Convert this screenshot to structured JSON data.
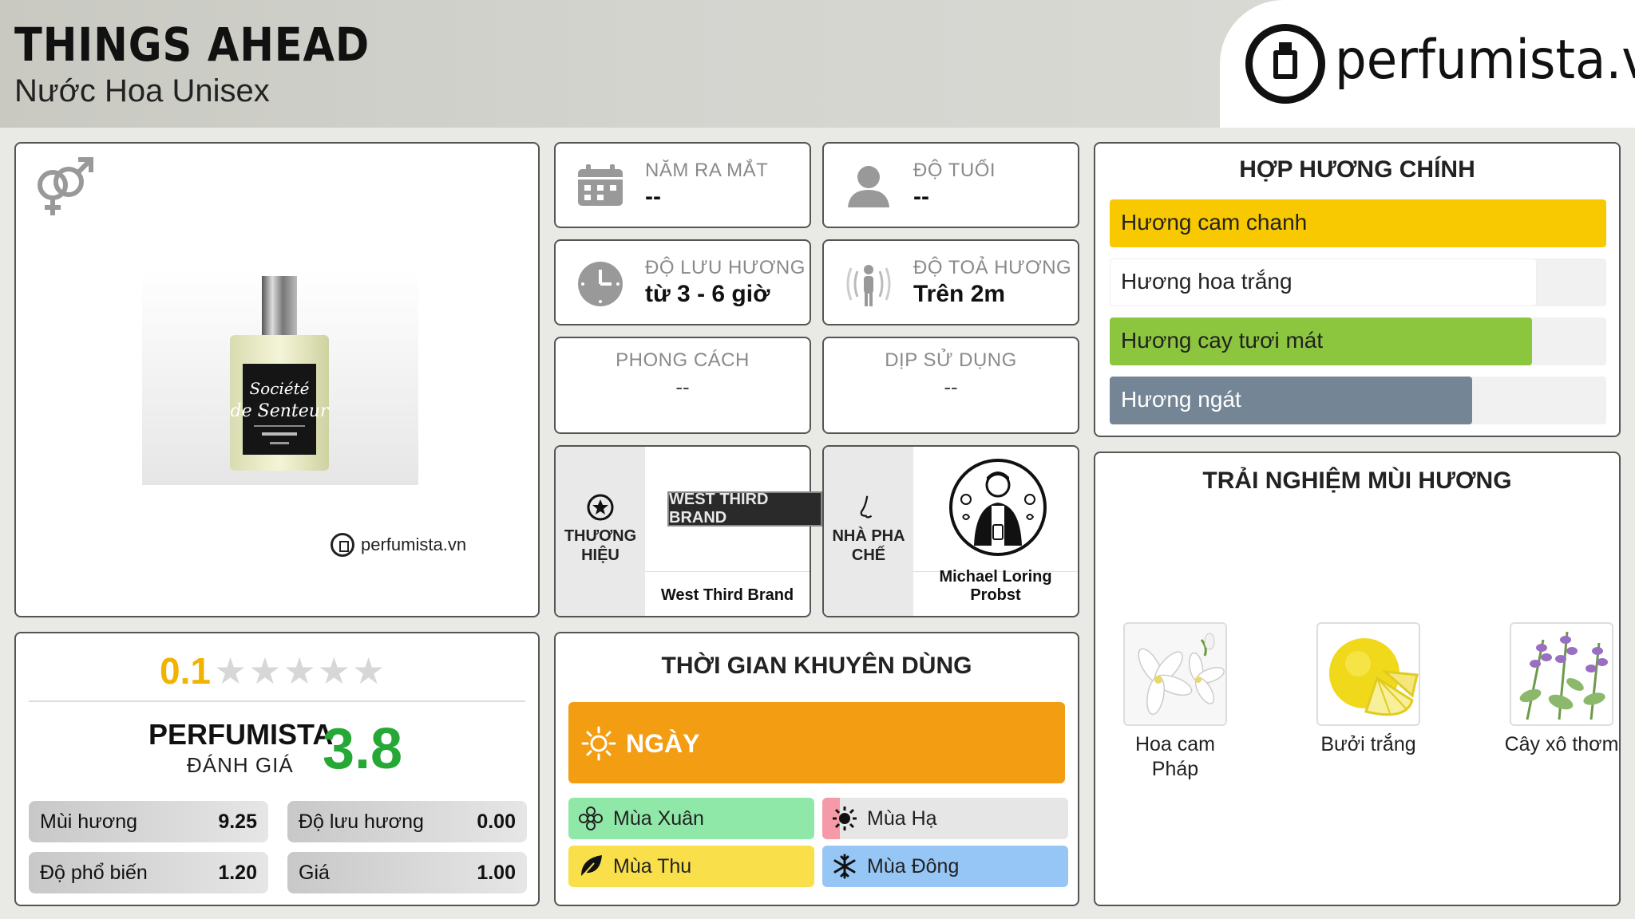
{
  "header": {
    "title": "THINGS AHEAD",
    "subtitle": "Nước Hoa Unisex",
    "site": "perfumista.vn"
  },
  "product": {
    "watermark": "perfumista.vn",
    "gender_icon": "unisex-gender-icon"
  },
  "info": {
    "release": {
      "label": "NĂM RA MẮT",
      "value": "--"
    },
    "age": {
      "label": "ĐỘ TUỔI",
      "value": "--"
    },
    "longevity": {
      "label": "ĐỘ LƯU HƯƠNG",
      "value": "từ 3 - 6 giờ"
    },
    "sillage": {
      "label": "ĐỘ TOẢ HƯƠNG",
      "value": "Trên 2m"
    },
    "style": {
      "label": "PHONG CÁCH",
      "value": "--"
    },
    "occasion": {
      "label": "DỊP SỬ DỤNG",
      "value": "--"
    }
  },
  "brand": {
    "label": "THƯƠNG HIỆU",
    "name": "West Third Brand",
    "logo_text": "WEST THIRD BRAND"
  },
  "perfumer": {
    "label": "NHÀ PHA CHẾ",
    "name": "Michael Loring Probst"
  },
  "accords": {
    "title": "HỢP HƯƠNG CHÍNH",
    "items": [
      {
        "label": "Hương cam chanh",
        "level": 1.0,
        "color": "#f8c800"
      },
      {
        "label": "Hương hoa trắng",
        "level": 0.86,
        "color": "#ffffff"
      },
      {
        "label": "Hương cay tươi mát",
        "level": 0.85,
        "color": "#8cc63e"
      },
      {
        "label": "Hương ngát",
        "level": 0.73,
        "color": "#748595"
      }
    ]
  },
  "rating": {
    "score": "0.1",
    "stars_filled": 0,
    "stars_total": 5,
    "brand_label": "PERFUMISTA",
    "sub_label": "ĐÁNH GIÁ",
    "brand_score": "3.8",
    "metrics": [
      {
        "label": "Mùi hương",
        "value": "9.25"
      },
      {
        "label": "Độ lưu hương",
        "value": "0.00"
      },
      {
        "label": "Độ phổ biến",
        "value": "1.20"
      },
      {
        "label": "Giá",
        "value": "1.00"
      }
    ]
  },
  "time": {
    "title": "THỜI GIAN KHUYÊN DÙNG",
    "day": "NGÀY",
    "seasons": [
      {
        "label": "Mùa Xuân",
        "color": "#90e8a8",
        "icon": "flower-icon"
      },
      {
        "label": "Mùa Hạ",
        "color": "#e6e6e6",
        "icon": "sun-icon"
      },
      {
        "label": "Mùa Thu",
        "color": "#f9e04a",
        "icon": "leaf-icon"
      },
      {
        "label": "Mùa Đông",
        "color": "#96c6f5",
        "icon": "snowflake-icon"
      }
    ]
  },
  "notes": {
    "title": "TRẢI NGHIỆM MÙI HƯƠNG",
    "items": [
      {
        "label": "Hoa cam Pháp"
      },
      {
        "label": "Bưởi trắng"
      },
      {
        "label": "Cây xô thơm"
      }
    ]
  }
}
